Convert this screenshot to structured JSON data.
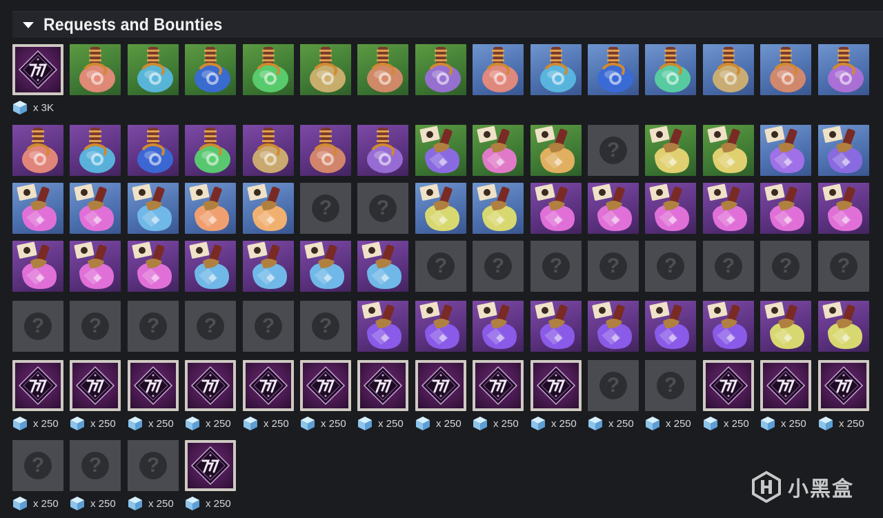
{
  "section": {
    "title": "Requests and Bounties",
    "expand_icon": "triangle-down-icon"
  },
  "colors": {
    "page_bg": "#1b1c20",
    "header_bg": "#24262b",
    "tile_green": "#4a8a3a",
    "tile_blue": "#5a80c0",
    "tile_purple": "#6a3c92",
    "tile_unknown": "#494b50",
    "engram_frame": "#cfcac2",
    "shard_cube": "#9fd0f0"
  },
  "rows": [
    {
      "tiles": [
        {
          "type": "engram"
        },
        {
          "type": "potion",
          "bg": "green",
          "liquid": "#e88a7a",
          "mark": "flask-icon"
        },
        {
          "type": "potion",
          "bg": "green",
          "liquid": "#5ab8e0",
          "mark": "flask-icon"
        },
        {
          "type": "potion",
          "bg": "green",
          "liquid": "#3a6ad8",
          "mark": "flask-icon"
        },
        {
          "type": "potion",
          "bg": "green",
          "liquid": "#5ad070",
          "mark": "flask-icon"
        },
        {
          "type": "potion",
          "bg": "green",
          "liquid": "#d0b070",
          "mark": "flask-icon"
        },
        {
          "type": "potion",
          "bg": "green",
          "liquid": "#d88a6a",
          "mark": "flask-icon"
        },
        {
          "type": "potion",
          "bg": "green",
          "liquid": "#9a70d8",
          "mark": "flask-icon"
        },
        {
          "type": "potion",
          "bg": "blue",
          "liquid": "#e88a7a",
          "mark": "flask-icon"
        },
        {
          "type": "potion",
          "bg": "blue",
          "liquid": "#5ab8e0",
          "mark": "flask-icon"
        },
        {
          "type": "potion",
          "bg": "blue",
          "liquid": "#3a6ad8",
          "mark": "flask-icon"
        },
        {
          "type": "potion",
          "bg": "blue",
          "liquid": "#5ad0a0",
          "mark": "flask-icon"
        },
        {
          "type": "potion",
          "bg": "blue",
          "liquid": "#d0b070",
          "mark": "flask-icon"
        },
        {
          "type": "potion",
          "bg": "blue",
          "liquid": "#d88a6a",
          "mark": "flask-icon"
        },
        {
          "type": "potion",
          "bg": "blue",
          "liquid": "#b070d8",
          "mark": "flask-icon"
        }
      ],
      "quantities": [
        {
          "col": 0,
          "text": "x 3K"
        }
      ]
    },
    {
      "tiles": [
        {
          "type": "potion",
          "bg": "purple",
          "liquid": "#e88a7a",
          "mark": "flask-icon"
        },
        {
          "type": "potion",
          "bg": "purple",
          "liquid": "#5ab8e0",
          "mark": "flask-icon"
        },
        {
          "type": "potion",
          "bg": "purple",
          "liquid": "#3a6ad8",
          "mark": "flask-icon"
        },
        {
          "type": "potion",
          "bg": "purple",
          "liquid": "#5ad070",
          "mark": "flask-icon"
        },
        {
          "type": "potion",
          "bg": "purple",
          "liquid": "#d0b070",
          "mark": "flask-icon"
        },
        {
          "type": "potion",
          "bg": "purple",
          "liquid": "#d88a6a",
          "mark": "flask-icon"
        },
        {
          "type": "potion",
          "bg": "purple",
          "liquid": "#9a70d8",
          "mark": "flask-icon"
        },
        {
          "type": "bottle",
          "bg": "green",
          "liquid": "#8a6ae0",
          "mark": "tag-icon"
        },
        {
          "type": "bottle",
          "bg": "green",
          "liquid": "#e07ac8",
          "mark": "tag-icon"
        },
        {
          "type": "bottle",
          "bg": "green",
          "liquid": "#e0b060",
          "mark": "tag-icon"
        },
        {
          "type": "unknown"
        },
        {
          "type": "bottle",
          "bg": "green",
          "liquid": "#e0d070",
          "mark": "tag-icon"
        },
        {
          "type": "bottle",
          "bg": "green",
          "liquid": "#e0d070",
          "mark": "tag-icon"
        },
        {
          "type": "bottle",
          "bg": "blue",
          "liquid": "#a070e8",
          "mark": "tag-icon"
        },
        {
          "type": "bottle",
          "bg": "blue",
          "liquid": "#8a6ae0",
          "mark": "tag-icon"
        }
      ],
      "quantities": []
    },
    {
      "tiles": [
        {
          "type": "bottle",
          "bg": "blue",
          "liquid": "#e070d8",
          "mark": "tag-icon"
        },
        {
          "type": "bottle",
          "bg": "blue",
          "liquid": "#e070d8",
          "mark": "tag-icon"
        },
        {
          "type": "bottle",
          "bg": "blue",
          "liquid": "#70b8e8",
          "mark": "tag-icon"
        },
        {
          "type": "bottle",
          "bg": "blue",
          "liquid": "#f0a070",
          "mark": "tag-icon"
        },
        {
          "type": "bottle",
          "bg": "blue",
          "liquid": "#f0b070",
          "mark": "tag-icon"
        },
        {
          "type": "unknown"
        },
        {
          "type": "unknown"
        },
        {
          "type": "bottle",
          "bg": "blue",
          "liquid": "#d8d870",
          "mark": "tag-icon"
        },
        {
          "type": "bottle",
          "bg": "blue",
          "liquid": "#d8d870",
          "mark": "tag-icon"
        },
        {
          "type": "bottle",
          "bg": "purple",
          "liquid": "#e070d8",
          "mark": "tag-icon"
        },
        {
          "type": "bottle",
          "bg": "purple",
          "liquid": "#e070d8",
          "mark": "tag-icon"
        },
        {
          "type": "bottle",
          "bg": "purple",
          "liquid": "#e070d8",
          "mark": "tag-icon"
        },
        {
          "type": "bottle",
          "bg": "purple",
          "liquid": "#e070d8",
          "mark": "tag-icon"
        },
        {
          "type": "bottle",
          "bg": "purple",
          "liquid": "#e070d8",
          "mark": "tag-icon"
        },
        {
          "type": "bottle",
          "bg": "purple",
          "liquid": "#e070d8",
          "mark": "tag-icon"
        }
      ],
      "quantities": []
    },
    {
      "tiles": [
        {
          "type": "bottle",
          "bg": "purple",
          "liquid": "#e070d8",
          "mark": "tag-icon"
        },
        {
          "type": "bottle",
          "bg": "purple",
          "liquid": "#e070d8",
          "mark": "tag-icon"
        },
        {
          "type": "bottle",
          "bg": "purple",
          "liquid": "#e070d8",
          "mark": "tag-icon"
        },
        {
          "type": "bottle",
          "bg": "purple",
          "liquid": "#70b8e8",
          "mark": "tag-icon"
        },
        {
          "type": "bottle",
          "bg": "purple",
          "liquid": "#70b8e8",
          "mark": "tag-icon"
        },
        {
          "type": "bottle",
          "bg": "purple",
          "liquid": "#70b8e8",
          "mark": "tag-icon"
        },
        {
          "type": "bottle",
          "bg": "purple",
          "liquid": "#70b8e8",
          "mark": "tag-icon"
        },
        {
          "type": "unknown"
        },
        {
          "type": "unknown"
        },
        {
          "type": "unknown"
        },
        {
          "type": "unknown"
        },
        {
          "type": "unknown"
        },
        {
          "type": "unknown"
        },
        {
          "type": "unknown"
        },
        {
          "type": "unknown"
        }
      ],
      "quantities": []
    },
    {
      "tiles": [
        {
          "type": "unknown"
        },
        {
          "type": "unknown"
        },
        {
          "type": "unknown"
        },
        {
          "type": "unknown"
        },
        {
          "type": "unknown"
        },
        {
          "type": "unknown"
        },
        {
          "type": "bottle",
          "bg": "purple",
          "liquid": "#8a5ae8",
          "mark": "tag-icon"
        },
        {
          "type": "bottle",
          "bg": "purple",
          "liquid": "#8a5ae8",
          "mark": "tag-icon"
        },
        {
          "type": "bottle",
          "bg": "purple",
          "liquid": "#8a5ae8",
          "mark": "tag-icon"
        },
        {
          "type": "bottle",
          "bg": "purple",
          "liquid": "#8a5ae8",
          "mark": "tag-icon"
        },
        {
          "type": "bottle",
          "bg": "purple",
          "liquid": "#8a5ae8",
          "mark": "tag-icon"
        },
        {
          "type": "bottle",
          "bg": "purple",
          "liquid": "#8a5ae8",
          "mark": "tag-icon"
        },
        {
          "type": "bottle",
          "bg": "purple",
          "liquid": "#8a5ae8",
          "mark": "tag-icon"
        },
        {
          "type": "bottle",
          "bg": "purple",
          "liquid": "#d8d870",
          "mark": "tag-icon"
        },
        {
          "type": "bottle",
          "bg": "purple",
          "liquid": "#d8d870",
          "mark": "tag-icon"
        }
      ],
      "quantities": []
    },
    {
      "tiles": [
        {
          "type": "engram"
        },
        {
          "type": "engram"
        },
        {
          "type": "engram"
        },
        {
          "type": "engram"
        },
        {
          "type": "engram"
        },
        {
          "type": "engram"
        },
        {
          "type": "engram"
        },
        {
          "type": "engram"
        },
        {
          "type": "engram"
        },
        {
          "type": "engram"
        },
        {
          "type": "unknown"
        },
        {
          "type": "unknown"
        },
        {
          "type": "engram"
        },
        {
          "type": "engram"
        },
        {
          "type": "engram"
        }
      ],
      "quantities": [
        {
          "col": 0,
          "text": "x 250"
        },
        {
          "col": 1,
          "text": "x 250"
        },
        {
          "col": 2,
          "text": "x 250"
        },
        {
          "col": 3,
          "text": "x 250"
        },
        {
          "col": 4,
          "text": "x 250"
        },
        {
          "col": 5,
          "text": "x 250"
        },
        {
          "col": 6,
          "text": "x 250"
        },
        {
          "col": 7,
          "text": "x 250"
        },
        {
          "col": 8,
          "text": "x 250"
        },
        {
          "col": 9,
          "text": "x 250"
        },
        {
          "col": 10,
          "text": "x 250"
        },
        {
          "col": 11,
          "text": "x 250"
        },
        {
          "col": 12,
          "text": "x 250"
        },
        {
          "col": 13,
          "text": "x 250"
        },
        {
          "col": 14,
          "text": "x 250"
        }
      ]
    },
    {
      "tiles": [
        {
          "type": "unknown"
        },
        {
          "type": "unknown"
        },
        {
          "type": "unknown"
        },
        {
          "type": "engram"
        }
      ],
      "quantities": [
        {
          "col": 0,
          "text": "x 250"
        },
        {
          "col": 1,
          "text": "x 250"
        },
        {
          "col": 2,
          "text": "x 250"
        },
        {
          "col": 3,
          "text": "x 250"
        }
      ]
    }
  ],
  "unknown_glyph": "?",
  "watermark": {
    "text": "小黑盒",
    "logo_icon": "xiaoheihe-logo-icon"
  }
}
